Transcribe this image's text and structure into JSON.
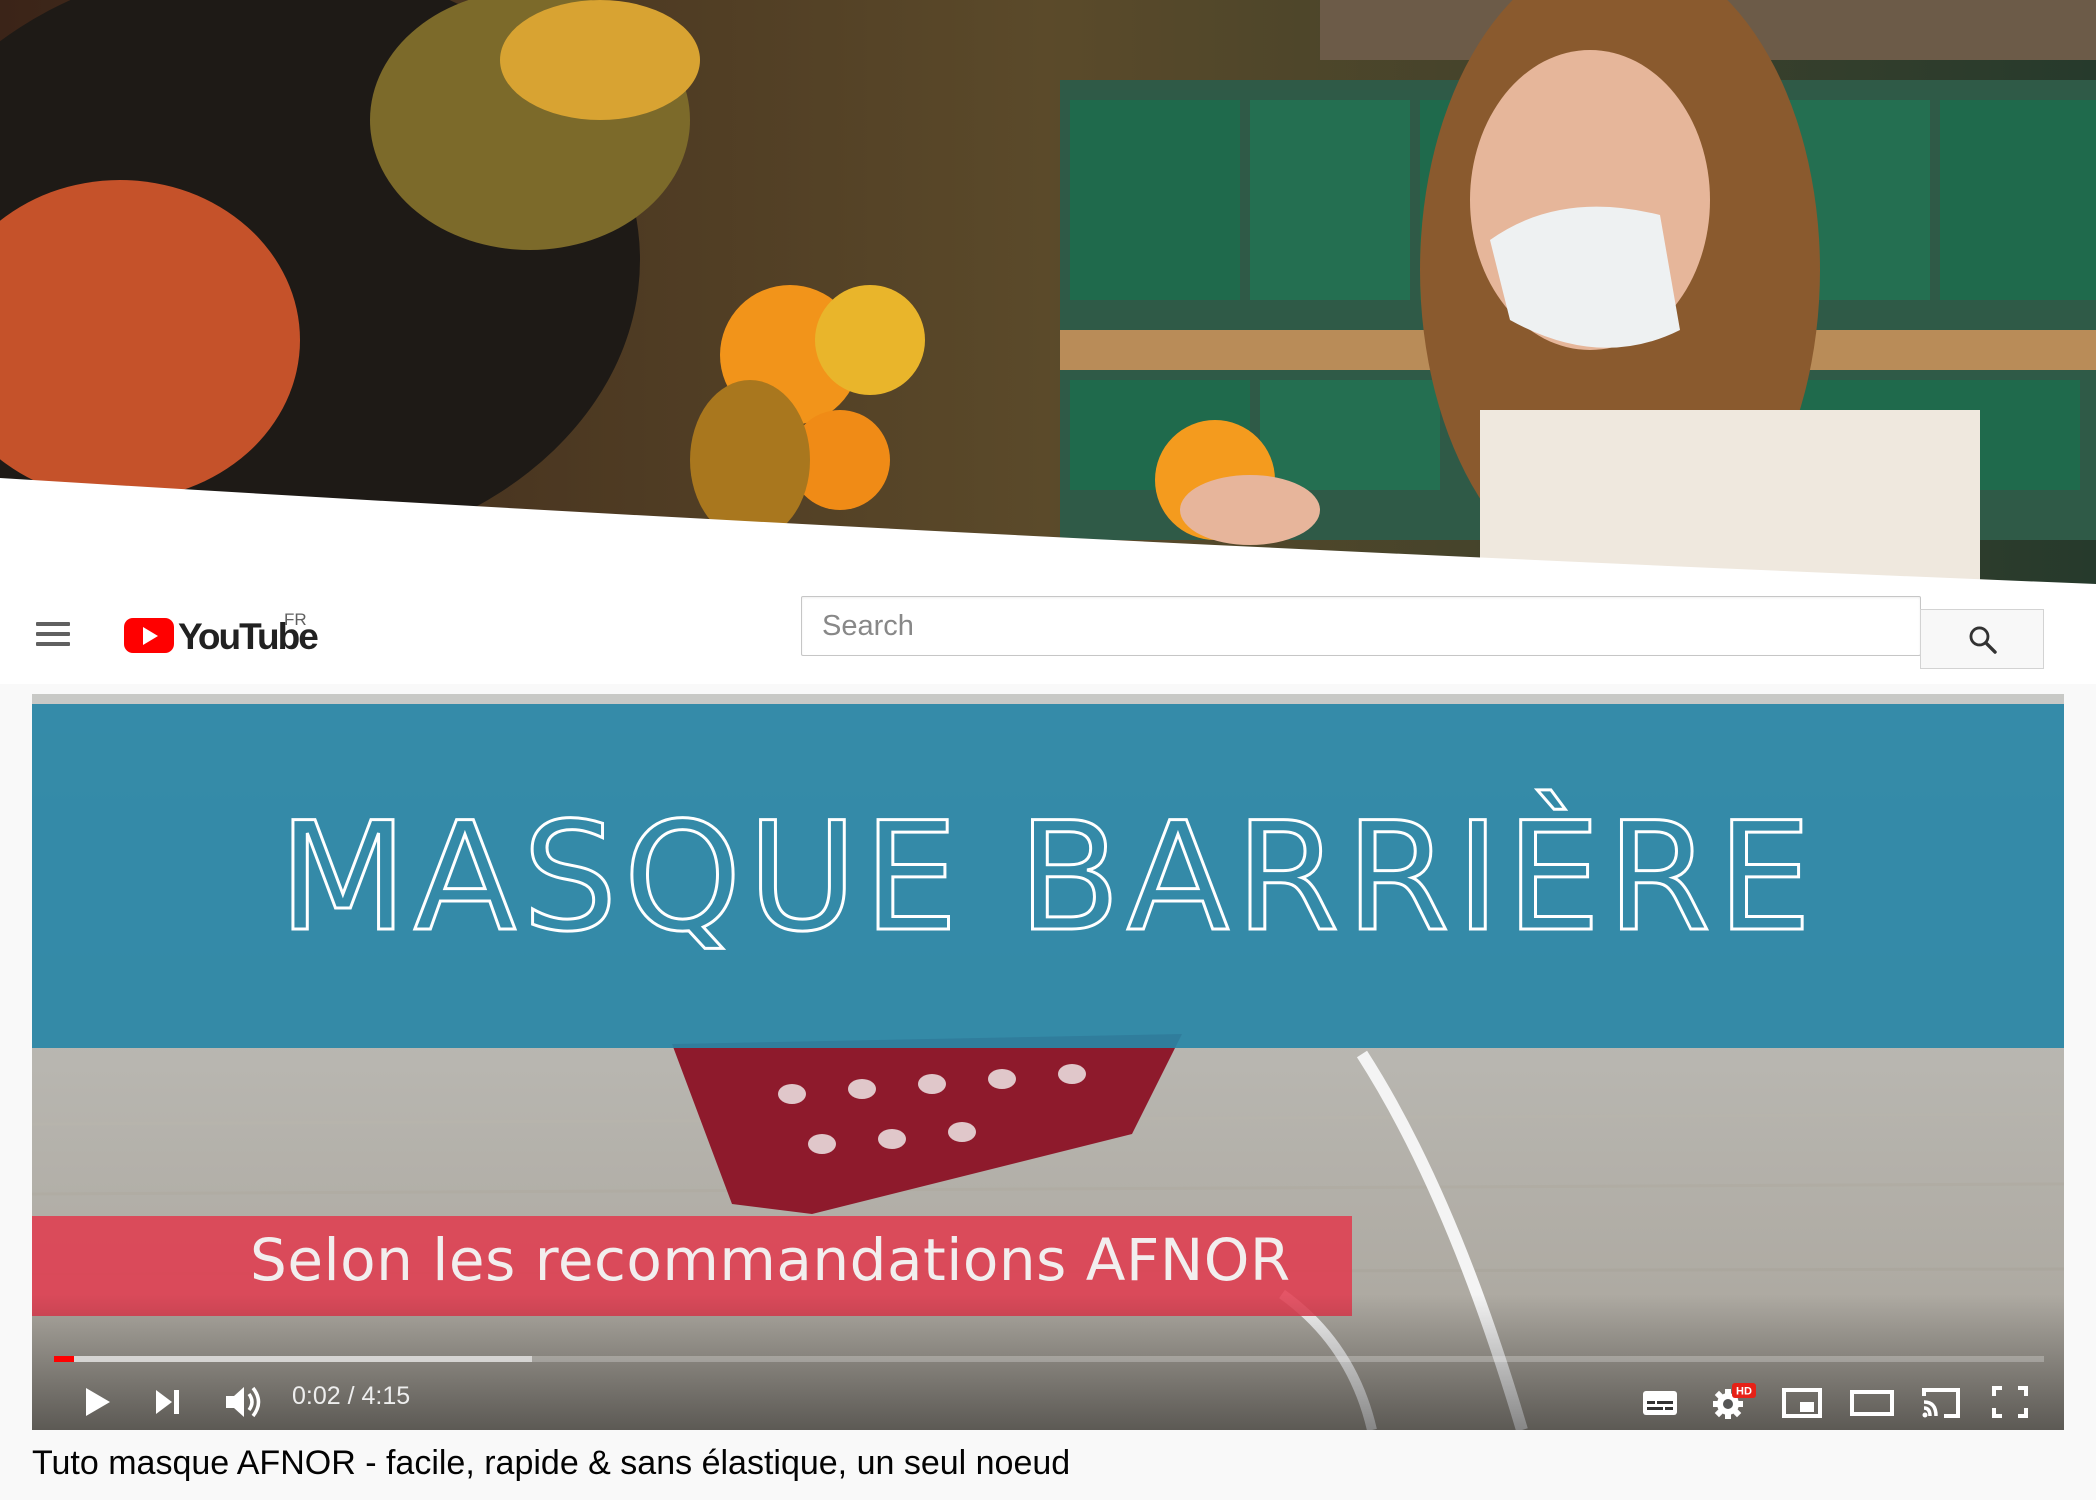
{
  "masthead": {
    "logo_text": "YouTube",
    "country_code": "FR",
    "search": {
      "placeholder": "Search",
      "value": ""
    }
  },
  "player": {
    "overlay_title": "MASQUE BARRIÈRE",
    "overlay_subtitle": "Selon les recommandations AFNOR",
    "time": {
      "current": "0:02",
      "duration": "4:15",
      "separator": " / "
    },
    "progress_fraction": 0.008,
    "buffered_fraction": 0.24,
    "controls": [
      "play-icon",
      "next-icon",
      "volume-icon",
      "subtitles-icon",
      "settings-icon",
      "hd-badge",
      "miniplayer-icon",
      "theater-icon",
      "cast-icon",
      "fullscreen-icon"
    ],
    "hd_badge": "HD"
  },
  "video": {
    "title": "Tuto masque AFNOR - facile, rapide & sans élastique, un seul noeud"
  },
  "colors": {
    "brand_red": "#ff0000",
    "title_band": "#2885a6",
    "subtitle_band": "#e13a4e"
  }
}
